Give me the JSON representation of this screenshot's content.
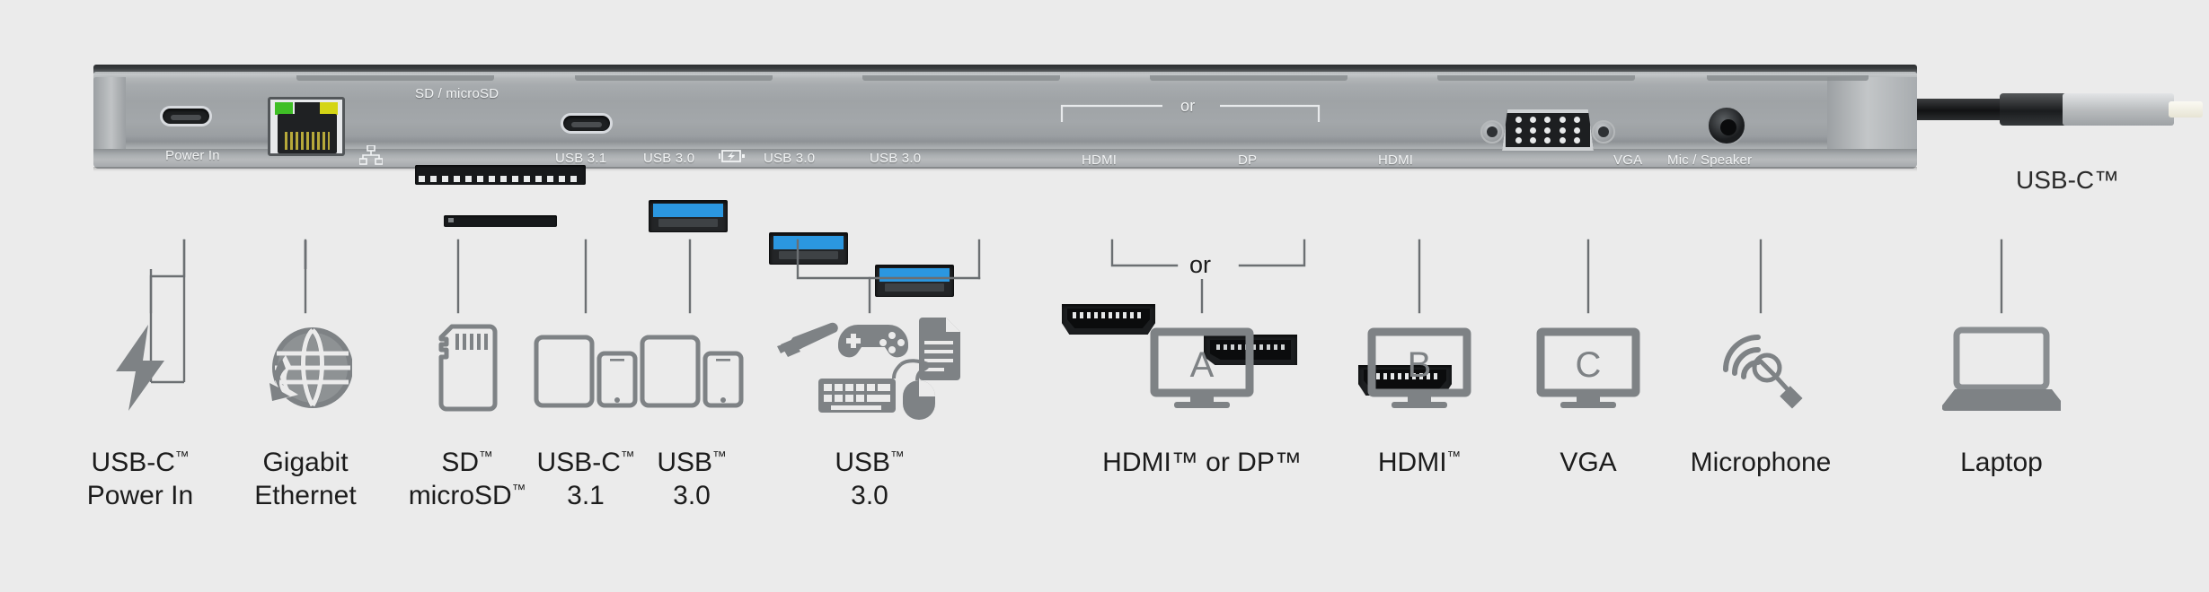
{
  "background_color": "#ebebeb",
  "dock": {
    "name": "usb-c-docking-station",
    "body_color": "#a5a9ac",
    "ports": [
      {
        "id": "power-in",
        "label": "Power In",
        "type": "usb-c-female"
      },
      {
        "id": "ethernet",
        "label": "",
        "type": "rj45",
        "led_green": "#3fbf26",
        "led_yellow": "#d4d515"
      },
      {
        "id": "sd-reader",
        "label": "SD / microSD",
        "type": "card-reader"
      },
      {
        "id": "usb-c-31",
        "label": "USB 3.1",
        "type": "usb-c-female"
      },
      {
        "id": "usb-a-1",
        "label": "USB 3.0",
        "type": "usb-a",
        "badge": "charging"
      },
      {
        "id": "usb-a-2",
        "label": "USB 3.0",
        "type": "usb-a"
      },
      {
        "id": "usb-a-3",
        "label": "USB 3.0",
        "type": "usb-a"
      },
      {
        "id": "hdmi-1",
        "label": "HDMI",
        "type": "hdmi"
      },
      {
        "id": "dp",
        "label": "DP",
        "type": "displayport"
      },
      {
        "id": "hdmi-2",
        "label": "HDMI",
        "type": "hdmi"
      },
      {
        "id": "vga",
        "label": "VGA",
        "type": "vga"
      },
      {
        "id": "audio",
        "label": "Mic / Speaker",
        "type": "audio-jack"
      }
    ],
    "or_bracket_label": "or",
    "cable": {
      "caption": "USB-C™",
      "connector": "usb-c-male"
    }
  },
  "legend": {
    "or_label": "or",
    "columns": [
      {
        "icon": "lightning-bolt-icon",
        "line1": "USB-C",
        "sup1": "™",
        "line2": "Power In",
        "sup2": ""
      },
      {
        "icon": "globe-download-icon",
        "line1": "Gigabit",
        "sup1": "",
        "line2": "Ethernet",
        "sup2": ""
      },
      {
        "icon": "sd-card-icon",
        "line1": "SD",
        "sup1": "™",
        "line2": "microSD",
        "sup2": "™"
      },
      {
        "icon": "tablet-phone-icon",
        "line1": "USB-C",
        "sup1": "™",
        "line2": "3.1",
        "sup2": ""
      },
      {
        "icon": "tablet-phone-icon",
        "line1": "USB",
        "sup1": "™",
        "line2": "3.0",
        "sup2": ""
      },
      {
        "icon": "usb-peripherals-icon",
        "line1": "USB",
        "sup1": "™",
        "line2": "3.0",
        "sup2": ""
      },
      {
        "icon": "monitor-a-icon",
        "line1": "HDMI™ or DP™",
        "sup1": "",
        "line2": "",
        "sup2": ""
      },
      {
        "icon": "monitor-b-icon",
        "line1": "HDMI",
        "sup1": "™",
        "line2": "",
        "sup2": ""
      },
      {
        "icon": "monitor-c-icon",
        "line1": "VGA",
        "sup1": "",
        "line2": "",
        "sup2": ""
      },
      {
        "icon": "microphone-icon",
        "line1": "Microphone",
        "sup1": "",
        "line2": "",
        "sup2": ""
      },
      {
        "icon": "laptop-icon",
        "line1": "Laptop",
        "sup1": "",
        "line2": "",
        "sup2": ""
      }
    ],
    "monitor_letters": {
      "a": "A",
      "b": "B",
      "c": "C"
    }
  }
}
